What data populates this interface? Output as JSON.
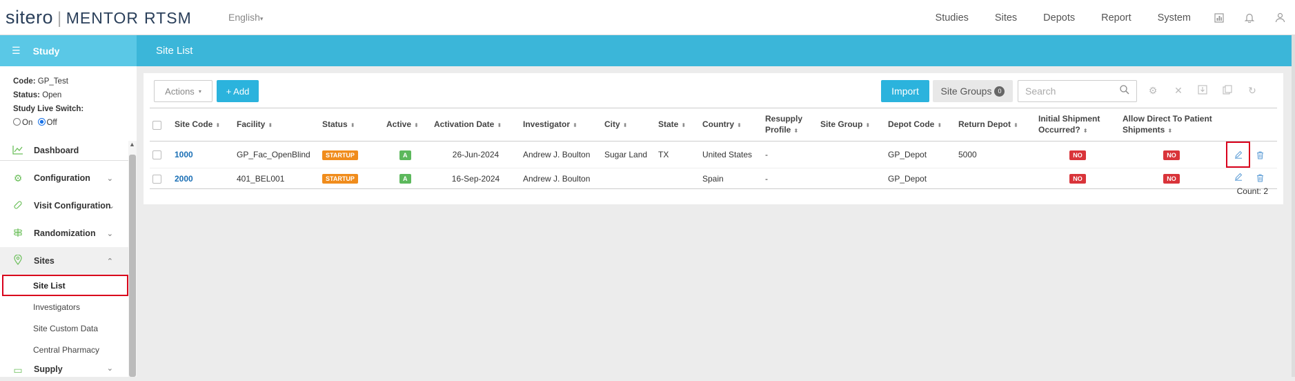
{
  "header": {
    "logo_brand": "sitero",
    "logo_product": "MENTOR",
    "logo_suffix": "RTSM",
    "language": "English",
    "nav": [
      "Studies",
      "Sites",
      "Depots",
      "Report",
      "System"
    ]
  },
  "sidebar": {
    "title": "Study",
    "code_label": "Code:",
    "code_value": "GP_Test",
    "status_label": "Status:",
    "status_value": "Open",
    "live_switch_label": "Study Live Switch:",
    "on_label": "On",
    "off_label": "Off",
    "items": [
      {
        "label": "Dashboard",
        "icon": "chart-line-icon"
      },
      {
        "label": "Configuration",
        "icon": "gear-icon"
      },
      {
        "label": "Visit Configuration",
        "icon": "pill-icon"
      },
      {
        "label": "Randomization",
        "icon": "signpost-icon"
      },
      {
        "label": "Sites",
        "icon": "map-pin-icon"
      },
      {
        "label": "Supply",
        "icon": "truck-icon"
      }
    ],
    "sites_sub": [
      "Site List",
      "Investigators",
      "Site Custom Data",
      "Central Pharmacy"
    ]
  },
  "main": {
    "title": "Site List",
    "actions_label": "Actions",
    "add_label": "+ Add",
    "import_label": "Import",
    "site_groups_label": "Site Groups",
    "site_groups_count": "0",
    "search_placeholder": "Search",
    "count_text": "Count: 2"
  },
  "table": {
    "columns": [
      "Site Code",
      "Facility",
      "Status",
      "Active",
      "Activation Date",
      "Investigator",
      "City",
      "State",
      "Country",
      "Resupply Profile",
      "Site Group",
      "Depot Code",
      "Return Depot",
      "Initial Shipment Occurred?",
      "Allow Direct To Patient Shipments"
    ],
    "rows": [
      {
        "site_code": "1000",
        "facility": "GP_Fac_OpenBlind",
        "status": "STARTUP",
        "active": "A",
        "activation_date": "26-Jun-2024",
        "investigator": "Andrew J. Boulton",
        "city": "Sugar Land",
        "state": "TX",
        "country": "United States",
        "resupply": "-",
        "site_group": "",
        "depot": "GP_Depot",
        "return_depot": "5000",
        "initial": "NO",
        "direct": "NO"
      },
      {
        "site_code": "2000",
        "facility": "401_BEL001",
        "status": "STARTUP",
        "active": "A",
        "activation_date": "16-Sep-2024",
        "investigator": "Andrew J. Boulton",
        "city": "",
        "state": "",
        "country": "Spain",
        "resupply": "-",
        "site_group": "",
        "depot": "GP_Depot",
        "return_depot": "",
        "initial": "NO",
        "direct": "NO"
      }
    ]
  },
  "colors": {
    "accent": "#3bb6d9",
    "sidebar_header": "#5ac8e6",
    "startup": "#f08c1c",
    "active": "#5cb85c",
    "no": "#d9343a",
    "highlight": "#d9001b"
  }
}
